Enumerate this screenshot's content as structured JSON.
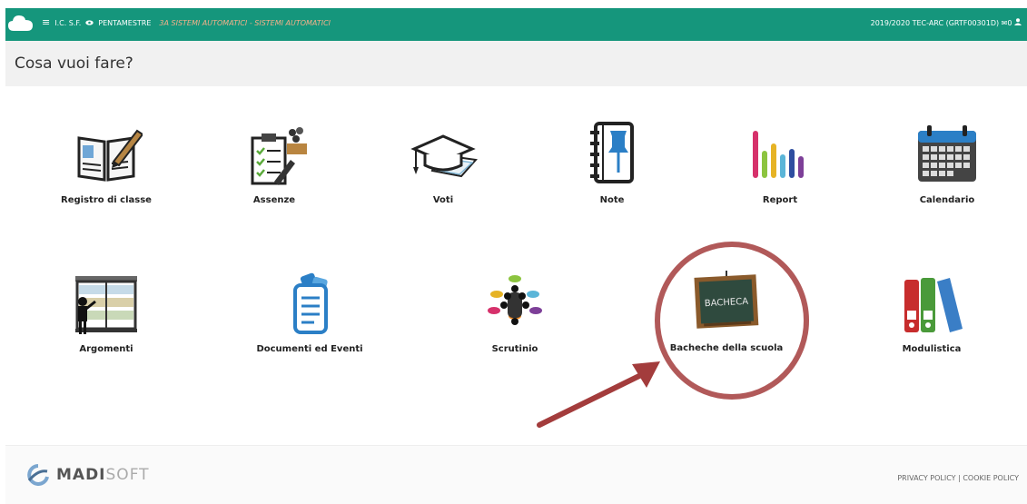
{
  "header": {
    "menu_icon": "≡",
    "school": "I.C. S.F.",
    "period_icon": "eye-icon",
    "period": "PENTAMESTRE",
    "class_name": "3A  SISTEMI AUTOMATICI - SISTEMI AUTOMATICI",
    "year_info": "2019/2020  TEC-ARC (GRTF00301D)",
    "mail_icon": "✉",
    "mail_count": "0",
    "user_icon": "user-icon",
    "accent": "#15967c"
  },
  "page_title": "Cosa vuoi fare?",
  "tiles": [
    {
      "label": "Registro di classe",
      "icon": "open-book-pen-icon"
    },
    {
      "label": "Assenze",
      "icon": "clipboard-checklist-icon"
    },
    {
      "label": "Voti",
      "icon": "graduation-cap-icon"
    },
    {
      "label": "Note",
      "icon": "notebook-pin-icon"
    },
    {
      "label": "Report",
      "icon": "bar-chart-icon"
    },
    {
      "label": "Calendario",
      "icon": "calendar-icon"
    },
    {
      "label": "Argomenti",
      "icon": "teacher-blackboard-icon"
    },
    {
      "label": "Documenti ed Eventi",
      "icon": "document-icon"
    },
    {
      "label": "Scrutinio",
      "icon": "meeting-icon"
    },
    {
      "label": "Bacheche della scuola",
      "icon": "blackboard-icon",
      "board_text": "BACHECA"
    },
    {
      "label": "Modulistica",
      "icon": "binders-icon"
    }
  ],
  "annotation": {
    "color": "#a33c3c"
  },
  "footer": {
    "logo_main": "MADI",
    "logo_soft": "SOFT",
    "privacy": "PRIVACY POLICY",
    "separator": "|",
    "cookie": "COOKIE POLICY"
  }
}
